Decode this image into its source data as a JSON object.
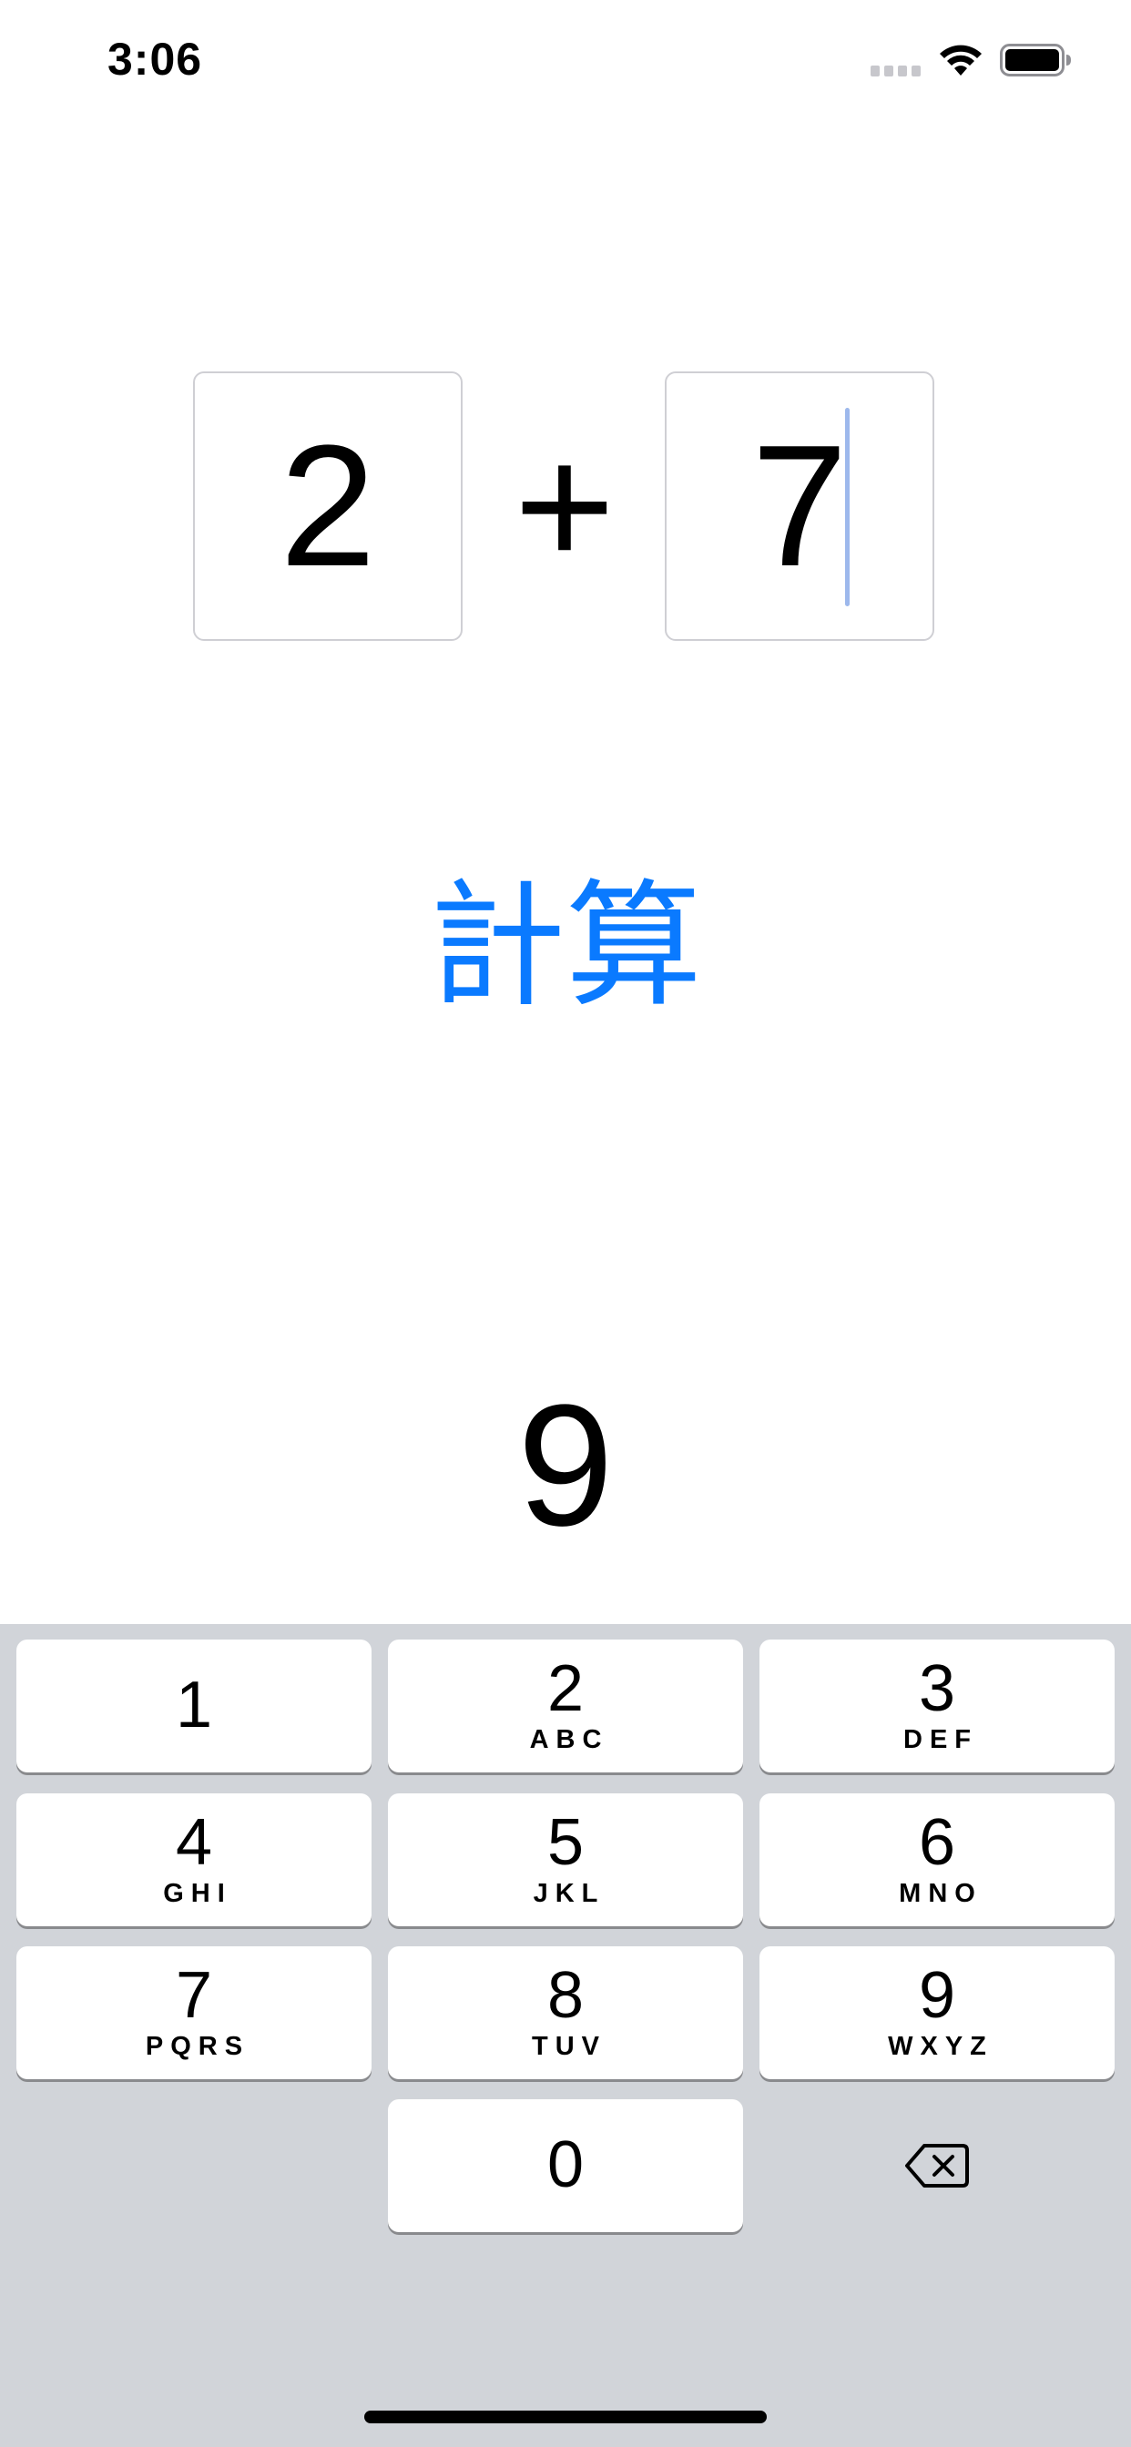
{
  "status_bar": {
    "time": "3:06",
    "icons": [
      "signal-icon",
      "wifi-icon",
      "battery-icon"
    ]
  },
  "equation": {
    "left_operand": "2",
    "operator": "+",
    "right_operand": "7"
  },
  "calculate_button": {
    "label": "計算",
    "color": "#0a7aff"
  },
  "result": {
    "value": "9"
  },
  "keypad": {
    "keys": [
      {
        "digit": "1",
        "letters": ""
      },
      {
        "digit": "2",
        "letters": "ABC"
      },
      {
        "digit": "3",
        "letters": "DEF"
      },
      {
        "digit": "4",
        "letters": "GHI"
      },
      {
        "digit": "5",
        "letters": "JKL"
      },
      {
        "digit": "6",
        "letters": "MNO"
      },
      {
        "digit": "7",
        "letters": "PQRS"
      },
      {
        "digit": "8",
        "letters": "TUV"
      },
      {
        "digit": "9",
        "letters": "WXYZ"
      },
      {
        "digit": "0",
        "letters": ""
      }
    ],
    "delete_icon": "delete-backspace-icon",
    "background_color": "#d1d4d9"
  }
}
